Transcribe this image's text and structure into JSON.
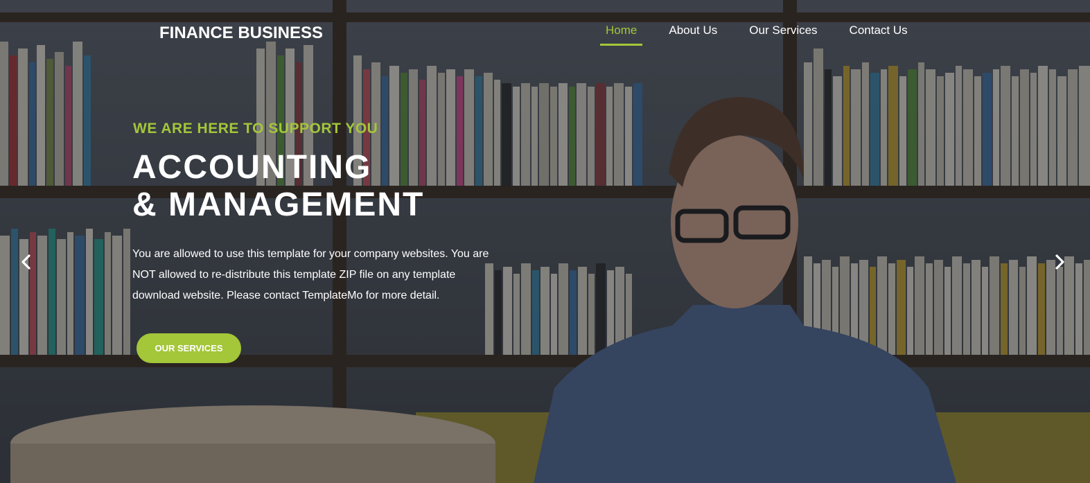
{
  "header": {
    "logo": "FINANCE BUSINESS",
    "nav": [
      {
        "label": "Home",
        "active": true
      },
      {
        "label": "About Us",
        "active": false
      },
      {
        "label": "Our Services",
        "active": false
      },
      {
        "label": "Contact Us",
        "active": false
      }
    ]
  },
  "hero": {
    "eyebrow": "WE ARE HERE TO SUPPORT YOU",
    "title_line1": "ACCOUNTING",
    "title_line2": "& MANAGEMENT",
    "description_line1": "You are allowed to use this template for your company websites. You are",
    "description_line2": "NOT allowed to re-distribute this template ZIP file on any template",
    "description_line3": "download website. Please contact TemplateMo for more detail.",
    "cta_label": "OUR SERVICES",
    "prev_icon": "chevron-left-icon",
    "next_icon": "chevron-right-icon"
  },
  "colors": {
    "accent": "#a4c639",
    "text": "#ffffff",
    "overlay": "#191c24"
  }
}
